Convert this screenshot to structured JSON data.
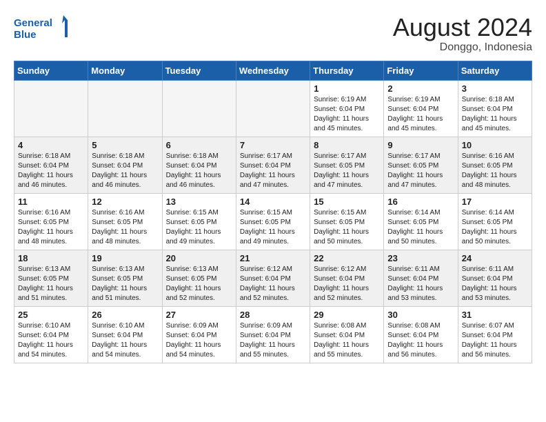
{
  "header": {
    "logo_line1": "General",
    "logo_line2": "Blue",
    "month_year": "August 2024",
    "location": "Donggo, Indonesia"
  },
  "weekdays": [
    "Sunday",
    "Monday",
    "Tuesday",
    "Wednesday",
    "Thursday",
    "Friday",
    "Saturday"
  ],
  "weeks": [
    [
      {
        "day": "",
        "info": ""
      },
      {
        "day": "",
        "info": ""
      },
      {
        "day": "",
        "info": ""
      },
      {
        "day": "",
        "info": ""
      },
      {
        "day": "1",
        "info": "Sunrise: 6:19 AM\nSunset: 6:04 PM\nDaylight: 11 hours\nand 45 minutes."
      },
      {
        "day": "2",
        "info": "Sunrise: 6:19 AM\nSunset: 6:04 PM\nDaylight: 11 hours\nand 45 minutes."
      },
      {
        "day": "3",
        "info": "Sunrise: 6:18 AM\nSunset: 6:04 PM\nDaylight: 11 hours\nand 45 minutes."
      }
    ],
    [
      {
        "day": "4",
        "info": "Sunrise: 6:18 AM\nSunset: 6:04 PM\nDaylight: 11 hours\nand 46 minutes."
      },
      {
        "day": "5",
        "info": "Sunrise: 6:18 AM\nSunset: 6:04 PM\nDaylight: 11 hours\nand 46 minutes."
      },
      {
        "day": "6",
        "info": "Sunrise: 6:18 AM\nSunset: 6:04 PM\nDaylight: 11 hours\nand 46 minutes."
      },
      {
        "day": "7",
        "info": "Sunrise: 6:17 AM\nSunset: 6:04 PM\nDaylight: 11 hours\nand 47 minutes."
      },
      {
        "day": "8",
        "info": "Sunrise: 6:17 AM\nSunset: 6:05 PM\nDaylight: 11 hours\nand 47 minutes."
      },
      {
        "day": "9",
        "info": "Sunrise: 6:17 AM\nSunset: 6:05 PM\nDaylight: 11 hours\nand 47 minutes."
      },
      {
        "day": "10",
        "info": "Sunrise: 6:16 AM\nSunset: 6:05 PM\nDaylight: 11 hours\nand 48 minutes."
      }
    ],
    [
      {
        "day": "11",
        "info": "Sunrise: 6:16 AM\nSunset: 6:05 PM\nDaylight: 11 hours\nand 48 minutes."
      },
      {
        "day": "12",
        "info": "Sunrise: 6:16 AM\nSunset: 6:05 PM\nDaylight: 11 hours\nand 48 minutes."
      },
      {
        "day": "13",
        "info": "Sunrise: 6:15 AM\nSunset: 6:05 PM\nDaylight: 11 hours\nand 49 minutes."
      },
      {
        "day": "14",
        "info": "Sunrise: 6:15 AM\nSunset: 6:05 PM\nDaylight: 11 hours\nand 49 minutes."
      },
      {
        "day": "15",
        "info": "Sunrise: 6:15 AM\nSunset: 6:05 PM\nDaylight: 11 hours\nand 50 minutes."
      },
      {
        "day": "16",
        "info": "Sunrise: 6:14 AM\nSunset: 6:05 PM\nDaylight: 11 hours\nand 50 minutes."
      },
      {
        "day": "17",
        "info": "Sunrise: 6:14 AM\nSunset: 6:05 PM\nDaylight: 11 hours\nand 50 minutes."
      }
    ],
    [
      {
        "day": "18",
        "info": "Sunrise: 6:13 AM\nSunset: 6:05 PM\nDaylight: 11 hours\nand 51 minutes."
      },
      {
        "day": "19",
        "info": "Sunrise: 6:13 AM\nSunset: 6:05 PM\nDaylight: 11 hours\nand 51 minutes."
      },
      {
        "day": "20",
        "info": "Sunrise: 6:13 AM\nSunset: 6:05 PM\nDaylight: 11 hours\nand 52 minutes."
      },
      {
        "day": "21",
        "info": "Sunrise: 6:12 AM\nSunset: 6:04 PM\nDaylight: 11 hours\nand 52 minutes."
      },
      {
        "day": "22",
        "info": "Sunrise: 6:12 AM\nSunset: 6:04 PM\nDaylight: 11 hours\nand 52 minutes."
      },
      {
        "day": "23",
        "info": "Sunrise: 6:11 AM\nSunset: 6:04 PM\nDaylight: 11 hours\nand 53 minutes."
      },
      {
        "day": "24",
        "info": "Sunrise: 6:11 AM\nSunset: 6:04 PM\nDaylight: 11 hours\nand 53 minutes."
      }
    ],
    [
      {
        "day": "25",
        "info": "Sunrise: 6:10 AM\nSunset: 6:04 PM\nDaylight: 11 hours\nand 54 minutes."
      },
      {
        "day": "26",
        "info": "Sunrise: 6:10 AM\nSunset: 6:04 PM\nDaylight: 11 hours\nand 54 minutes."
      },
      {
        "day": "27",
        "info": "Sunrise: 6:09 AM\nSunset: 6:04 PM\nDaylight: 11 hours\nand 54 minutes."
      },
      {
        "day": "28",
        "info": "Sunrise: 6:09 AM\nSunset: 6:04 PM\nDaylight: 11 hours\nand 55 minutes."
      },
      {
        "day": "29",
        "info": "Sunrise: 6:08 AM\nSunset: 6:04 PM\nDaylight: 11 hours\nand 55 minutes."
      },
      {
        "day": "30",
        "info": "Sunrise: 6:08 AM\nSunset: 6:04 PM\nDaylight: 11 hours\nand 56 minutes."
      },
      {
        "day": "31",
        "info": "Sunrise: 6:07 AM\nSunset: 6:04 PM\nDaylight: 11 hours\nand 56 minutes."
      }
    ]
  ]
}
